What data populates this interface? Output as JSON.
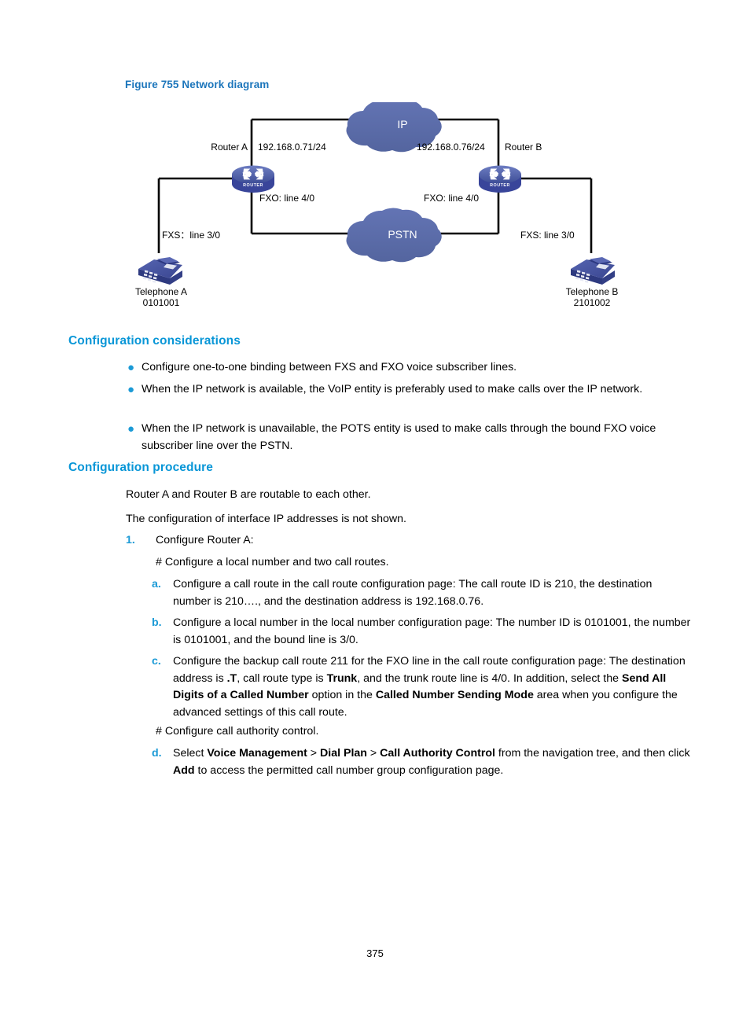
{
  "figure": {
    "caption": "Figure 755 Network diagram",
    "nodes": {
      "cloud_ip": "IP",
      "cloud_pstn": "PSTN",
      "router_a": "Router A",
      "router_b": "Router B",
      "router_badge": "ROUTER",
      "telephone_a_name": "Telephone A",
      "telephone_a_number": "0101001",
      "telephone_b_name": "Telephone B",
      "telephone_b_number": "2101002"
    },
    "labels": {
      "ip_left": "192.168.0.71/24",
      "ip_right": "192.168.0.76/24",
      "fxo_left": "FXO: line 4/0",
      "fxo_right": "FXO: line 4/0",
      "fxs_left": "FXS：line 3/0",
      "fxs_right": "FXS: line 3/0"
    },
    "colors": {
      "cloud": "#5b6cae",
      "router_body": "#4a5ba6",
      "router_top": "#5f70b8",
      "phone": "#4a57a8",
      "line": "#000000"
    }
  },
  "considerations": {
    "heading": "Configuration considerations",
    "bullet_glyph": "●",
    "items": [
      "Configure one-to-one binding between FXS and FXO voice subscriber lines.",
      "When the IP network is available, the VoIP entity is preferably used to make calls over the IP network.",
      "When the IP network is unavailable, the POTS entity is used to make calls through the bound FXO voice subscriber line over the PSTN."
    ]
  },
  "procedure": {
    "heading": "Configuration procedure",
    "intro_1": "Router A and Router B are routable to each other.",
    "intro_2": "The configuration of interface IP addresses is not shown.",
    "step_1": {
      "marker": "1.",
      "text": "Configure Router A:"
    },
    "comment_1": "# Configure a local number and two call routes.",
    "item_a": {
      "marker": "a.",
      "text": "Configure a call route in the call route configuration page: The call route ID is 210, the destination number is 210…., and the destination address is 192.168.0.76."
    },
    "item_b": {
      "marker": "b.",
      "text": "Configure a local number in the local number configuration page: The number ID is 0101001, the number is 0101001, and the bound line is 3/0."
    },
    "item_c": {
      "marker": "c.",
      "part1": "Configure the backup call route 211 for the FXO line in the call route configuration page: The destination address is ",
      "bold1": ".T",
      "part2": ", call route type is ",
      "bold2": "Trunk",
      "part3": ", and the trunk route line is 4/0. In addition, select the ",
      "bold3": "Send All Digits of a Called Number",
      "part4": " option in the ",
      "bold4": "Called Number Sending Mode",
      "part5": " area when you configure the advanced settings of this call route."
    },
    "comment_2": "# Configure call authority control.",
    "item_d": {
      "marker": "d.",
      "part1": "Select ",
      "bold1": "Voice Management",
      "sep1": " > ",
      "bold2": "Dial Plan",
      "sep2": " > ",
      "bold3": "Call Authority Control",
      "part2": " from the navigation tree, and then click ",
      "bold4": "Add",
      "part3": " to access the permitted call number group configuration page."
    }
  },
  "footer": {
    "page_number": "375"
  }
}
